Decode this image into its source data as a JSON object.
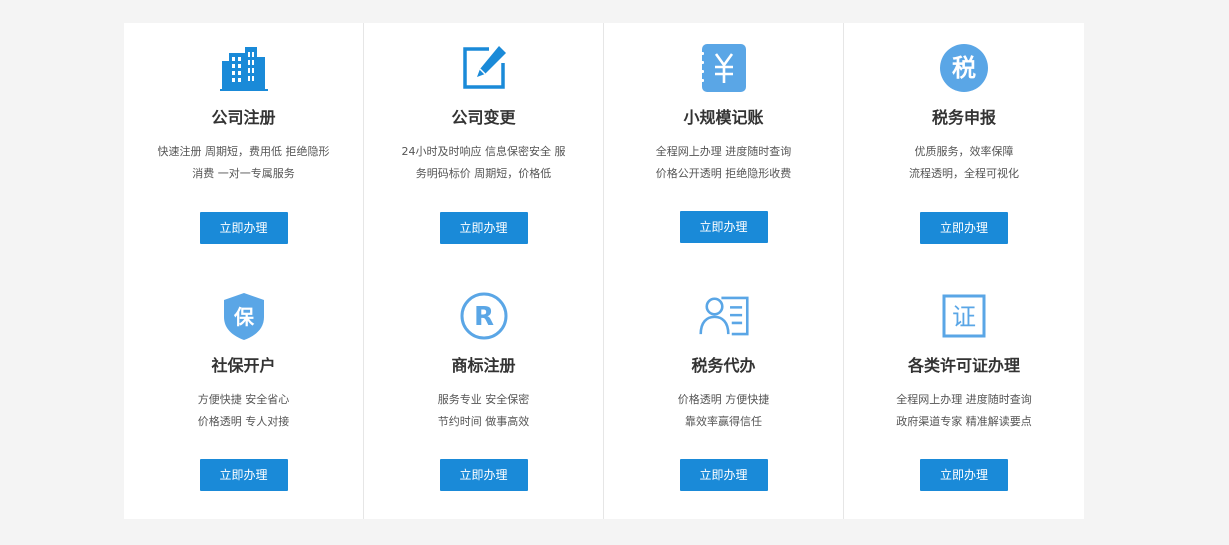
{
  "accent_color": "#1a8ad8",
  "cards": [
    {
      "title": "公司注册",
      "desc_line1": "快速注册 周期短，费用低 拒绝隐形",
      "desc_line2": "消费 一对一专属服务",
      "button": "立即办理",
      "icon": "building-icon"
    },
    {
      "title": "公司变更",
      "desc_line1": "24小时及时响应 信息保密安全 服",
      "desc_line2": "务明码标价 周期短，价格低",
      "button": "立即办理",
      "icon": "edit-icon"
    },
    {
      "title": "小规模记账",
      "desc_line1": "全程网上办理 进度随时查询",
      "desc_line2": "价格公开透明 拒绝隐形收费",
      "button": "立即办理",
      "icon": "yen-notebook-icon"
    },
    {
      "title": "税务申报",
      "desc_line1": "优质服务，效率保障",
      "desc_line2": "流程透明，全程可视化",
      "button": "立即办理",
      "icon": "tax-seal-icon"
    },
    {
      "title": "社保开户",
      "desc_line1": "方便快捷 安全省心",
      "desc_line2": "价格透明 专人对接",
      "button": "立即办理",
      "icon": "shield-icon"
    },
    {
      "title": "商标注册",
      "desc_line1": "服务专业 安全保密",
      "desc_line2": "节约时间 做事高效",
      "button": "立即办理",
      "icon": "registered-trademark-icon"
    },
    {
      "title": "税务代办",
      "desc_line1": "价格透明 方便快捷",
      "desc_line2": "靠效率赢得信任",
      "button": "立即办理",
      "icon": "person-document-icon"
    },
    {
      "title": "各类许可证办理",
      "desc_line1": "全程网上办理 进度随时查询",
      "desc_line2": "政府渠道专家 精准解读要点",
      "button": "立即办理",
      "icon": "certificate-icon"
    }
  ],
  "icon_glyphs": {
    "yen": "¥",
    "tax": "税",
    "shield": "保",
    "registered": "R",
    "certificate": "证"
  }
}
